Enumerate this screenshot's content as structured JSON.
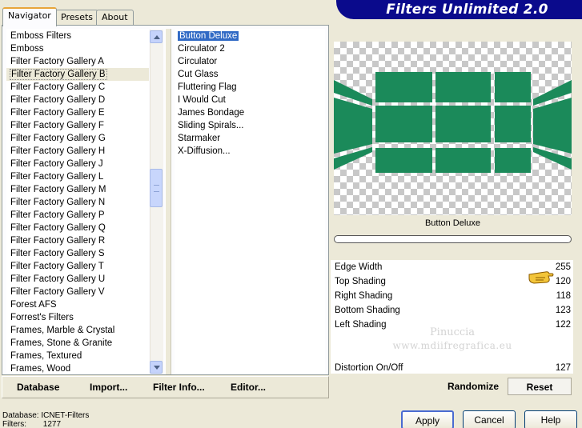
{
  "app": {
    "title": "Filters Unlimited 2.0"
  },
  "tabs": [
    {
      "label": "Navigator",
      "active": true
    },
    {
      "label": "Presets",
      "active": false
    },
    {
      "label": "About",
      "active": false
    }
  ],
  "categories": {
    "items": [
      "Emboss Filters",
      "Emboss",
      "Filter Factory Gallery A",
      "Filter Factory Gallery B",
      "Filter Factory Gallery C",
      "Filter Factory Gallery D",
      "Filter Factory Gallery E",
      "Filter Factory Gallery F",
      "Filter Factory Gallery G",
      "Filter Factory Gallery H",
      "Filter Factory Gallery J",
      "Filter Factory Gallery L",
      "Filter Factory Gallery M",
      "Filter Factory Gallery N",
      "Filter Factory Gallery P",
      "Filter Factory Gallery Q",
      "Filter Factory Gallery R",
      "Filter Factory Gallery S",
      "Filter Factory Gallery T",
      "Filter Factory Gallery U",
      "Filter Factory Gallery V",
      "Forest AFS",
      "Forrest's Filters",
      "Frames, Marble & Crystal",
      "Frames, Stone & Granite",
      "Frames, Textured",
      "Frames, Wood"
    ],
    "selected": "Filter Factory Gallery B"
  },
  "filters": {
    "items": [
      "Button Deluxe",
      "Circulator 2",
      "Circulator",
      "Cut Glass",
      "Fluttering Flag",
      "I Would Cut",
      "James Bondage",
      "Sliding Spirals...",
      "Starmaker",
      "X-Diffusion..."
    ],
    "selected": "Button Deluxe"
  },
  "preview": {
    "filter_name": "Button Deluxe",
    "tile_color": "#1b8a5a"
  },
  "params": [
    {
      "label": "Edge Width",
      "value": "255"
    },
    {
      "label": "Top Shading",
      "value": "120"
    },
    {
      "label": "Right Shading",
      "value": "118"
    },
    {
      "label": "Bottom Shading",
      "value": "123"
    },
    {
      "label": "Left Shading",
      "value": "122"
    },
    {
      "label": "Distortion On/Off",
      "value": "127"
    }
  ],
  "watermark": {
    "line1": "Pinuccia",
    "line2": "www.mdiifregrafica.eu"
  },
  "toolbar": {
    "database": "Database",
    "import": "Import...",
    "filter_info": "Filter Info...",
    "editor": "Editor...",
    "randomize": "Randomize",
    "reset": "Reset"
  },
  "status": {
    "database_label": "Database:",
    "database_value": "ICNET-Filters",
    "filters_label": "Filters:",
    "filters_value": "1277"
  },
  "dialog": {
    "apply": "Apply",
    "cancel": "Cancel",
    "help": "Help"
  }
}
